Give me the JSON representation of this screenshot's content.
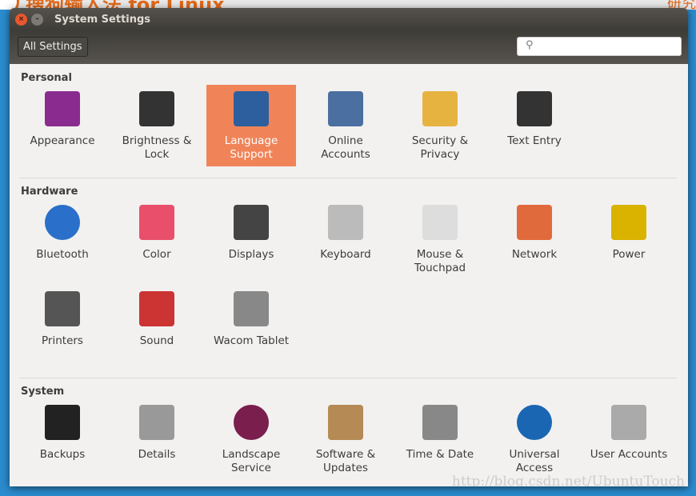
{
  "background": {
    "title": "搜狗输入法 for Linux",
    "right_text": "研究"
  },
  "window": {
    "title": "System Settings",
    "all_settings": "All Settings",
    "search_placeholder": ""
  },
  "sections": [
    {
      "name": "Personal",
      "items": [
        "Appearance",
        "Brightness & Lock",
        "Language Support",
        "Online Accounts",
        "Security & Privacy",
        "Text Entry"
      ]
    },
    {
      "name": "Hardware",
      "items": [
        "Bluetooth",
        "Color",
        "Displays",
        "Keyboard",
        "Mouse & Touchpad",
        "Network",
        "Power",
        "Printers",
        "Sound",
        "Wacom Tablet"
      ]
    },
    {
      "name": "System",
      "items": [
        "Backups",
        "Details",
        "Landscape Service",
        "Software & Updates",
        "Time & Date",
        "Universal Access",
        "User Accounts"
      ]
    }
  ],
  "selected": "Language Support",
  "watermark": "http://blog.csdn.net/UbuntuTouch"
}
